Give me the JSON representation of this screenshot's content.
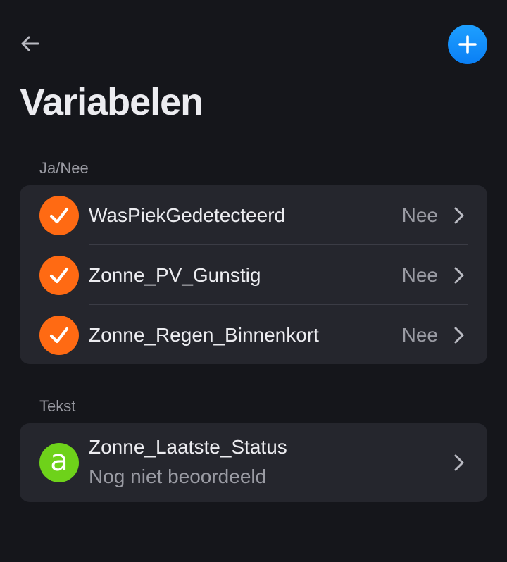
{
  "header": {
    "back_icon": "arrow-left-icon",
    "add_icon": "plus-icon",
    "title": "Variabelen",
    "accent_color": "#1a8fff"
  },
  "sections": [
    {
      "label": "Ja/Nee",
      "badge_color": "#ff6a13",
      "badge_icon": "checkmark-icon",
      "items": [
        {
          "name": "WasPiekGedetecteerd",
          "value": "Nee"
        },
        {
          "name": "Zonne_PV_Gunstig",
          "value": "Nee"
        },
        {
          "name": "Zonne_Regen_Binnenkort",
          "value": "Nee"
        }
      ]
    },
    {
      "label": "Tekst",
      "badge_color": "#6ed21a",
      "badge_letter": "a",
      "items": [
        {
          "name": "Zonne_Laatste_Status",
          "value": "Nog niet beoordeeld"
        }
      ]
    }
  ]
}
